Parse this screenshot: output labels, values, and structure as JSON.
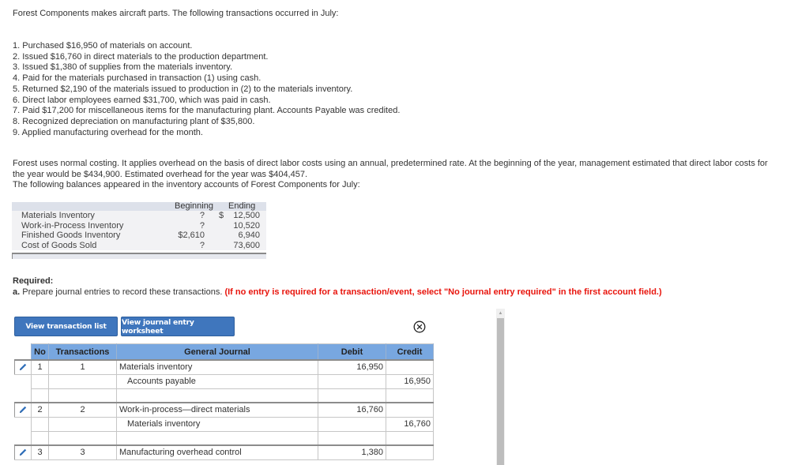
{
  "intro": "Forest Components makes aircraft parts. The following transactions occurred in July:",
  "transactions": [
    "1. Purchased $16,950 of materials on account.",
    "2. Issued $16,760 in direct materials to the production department.",
    "3. Issued $1,380 of supplies from the materials inventory.",
    "4. Paid for the materials purchased in transaction (1) using cash.",
    "5. Returned $2,190 of the materials issued to production in (2) to the materials inventory.",
    "6. Direct labor employees earned $31,700, which was paid in cash.",
    "7. Paid $17,200 for miscellaneous items for the manufacturing plant. Accounts Payable was credited.",
    "8. Recognized depreciation on manufacturing plant of $35,800.",
    "9. Applied manufacturing overhead for the month."
  ],
  "paragraph": {
    "line1": "Forest uses normal costing. It applies overhead on the basis of direct labor costs using an annual, predetermined rate. At the beginning of the year, management estimated that direct labor costs for",
    "line2": "the year would be $434,900. Estimated overhead for the year was $404,457.",
    "line3": "The following balances appeared in the inventory accounts of Forest Components for July:"
  },
  "balances": {
    "headers": {
      "beginning": "Beginning",
      "ending": "Ending"
    },
    "rows": [
      {
        "account": "Materials Inventory",
        "beginning": "?",
        "currency": "$",
        "ending": "12,500"
      },
      {
        "account": "Work-in-Process Inventory",
        "beginning": "?",
        "currency": "",
        "ending": "10,520"
      },
      {
        "account": "Finished Goods Inventory",
        "beginning": "$2,610",
        "currency": "",
        "ending": "6,940"
      },
      {
        "account": "Cost of Goods Sold",
        "beginning": "?",
        "currency": "",
        "ending": "73,600"
      }
    ]
  },
  "required": {
    "title": "Required:",
    "part_label": "a.",
    "instruction": " Prepare journal entries to record these transactions. ",
    "warning": "(If no entry is required for a transaction/event, select \"No journal entry required\" in the first account field.)"
  },
  "buttons": {
    "transaction_list": "View transaction list",
    "journal_worksheet": "View journal entry worksheet"
  },
  "journal": {
    "headers": {
      "no": "No",
      "transactions": "Transactions",
      "general_journal": "General Journal",
      "debit": "Debit",
      "credit": "Credit"
    },
    "entries": [
      {
        "no": "1",
        "transaction": "1",
        "lines": [
          {
            "account": "Materials inventory",
            "debit": "16,950",
            "credit": ""
          },
          {
            "account": "Accounts payable",
            "debit": "",
            "credit": "16,950"
          }
        ]
      },
      {
        "no": "2",
        "transaction": "2",
        "lines": [
          {
            "account": "Work-in-process—direct materials",
            "debit": "16,760",
            "credit": ""
          },
          {
            "account": "Materials inventory",
            "debit": "",
            "credit": "16,760"
          }
        ]
      },
      {
        "no": "3",
        "transaction": "3",
        "lines": [
          {
            "account": "Manufacturing overhead control",
            "debit": "1,380",
            "credit": ""
          }
        ]
      }
    ]
  },
  "colors": {
    "button_bg": "#3f76bd",
    "table_header_bg": "#78a7e0",
    "warning_red": "#e8140c",
    "pencil_blue": "#2f6fba"
  }
}
